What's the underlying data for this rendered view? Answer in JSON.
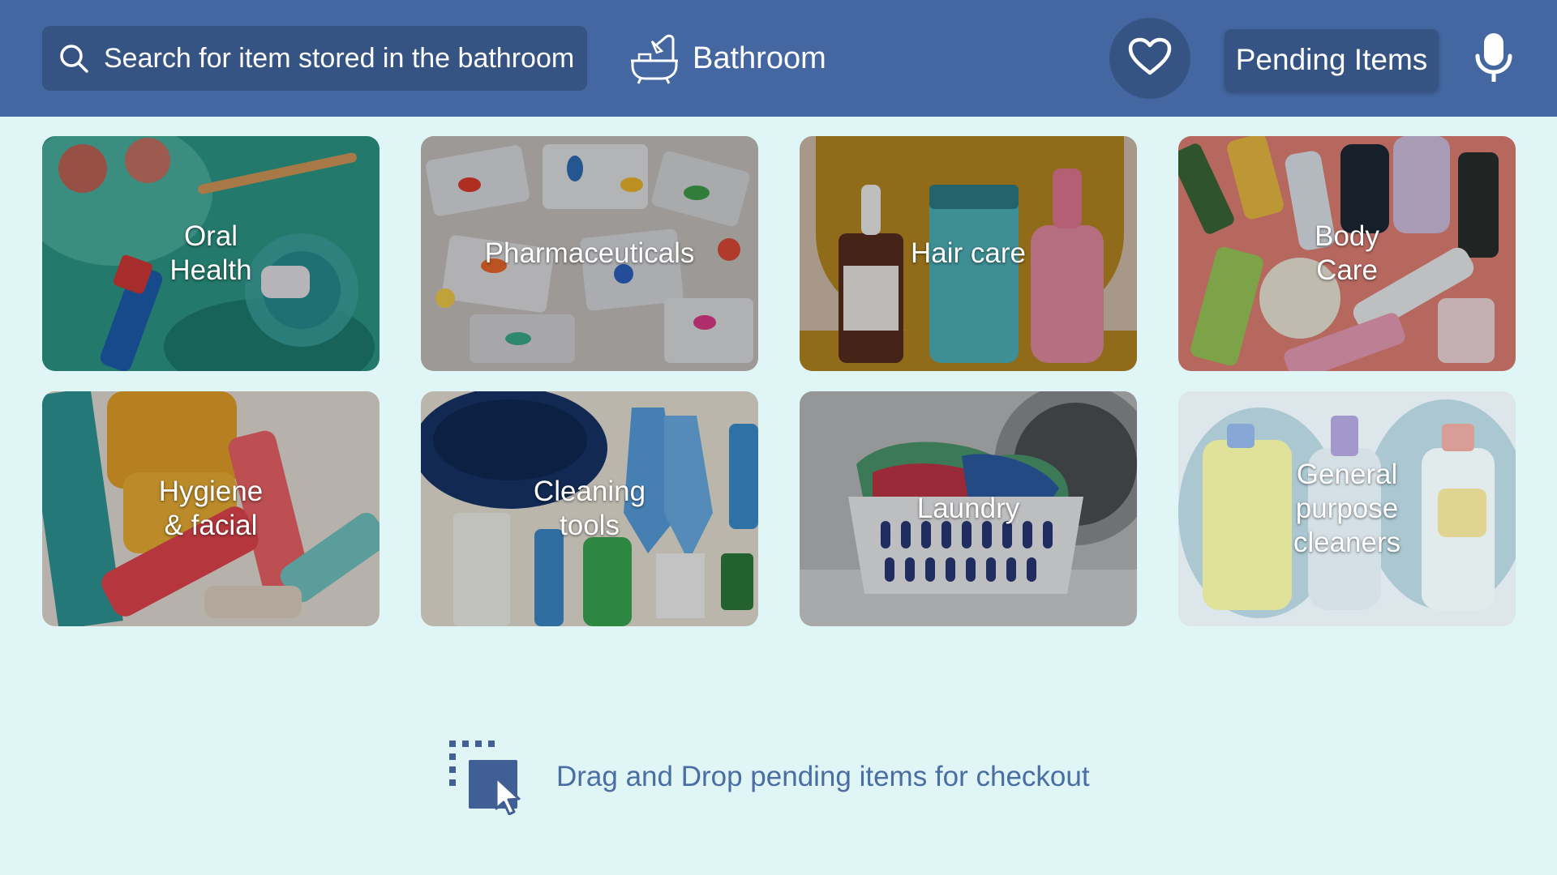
{
  "header": {
    "search_placeholder": "Search for item stored in the bathroom",
    "room_name": "Bathroom",
    "pending_label": "Pending Items"
  },
  "categories": [
    {
      "label": "Oral Health"
    },
    {
      "label": "Pharmaceuticals"
    },
    {
      "label": "Hair care"
    },
    {
      "label": "Body Care"
    },
    {
      "label": "Hygiene & facial"
    },
    {
      "label": "Cleaning tools"
    },
    {
      "label": "Laundry"
    },
    {
      "label": "General purpose cleaners"
    }
  ],
  "dropzone": {
    "text": "Drag and Drop pending items for checkout"
  },
  "colors": {
    "header_bg": "#4467a2",
    "control_bg": "#355484",
    "page_bg": "#dff5f6",
    "drop_text": "#4a6ea3"
  }
}
